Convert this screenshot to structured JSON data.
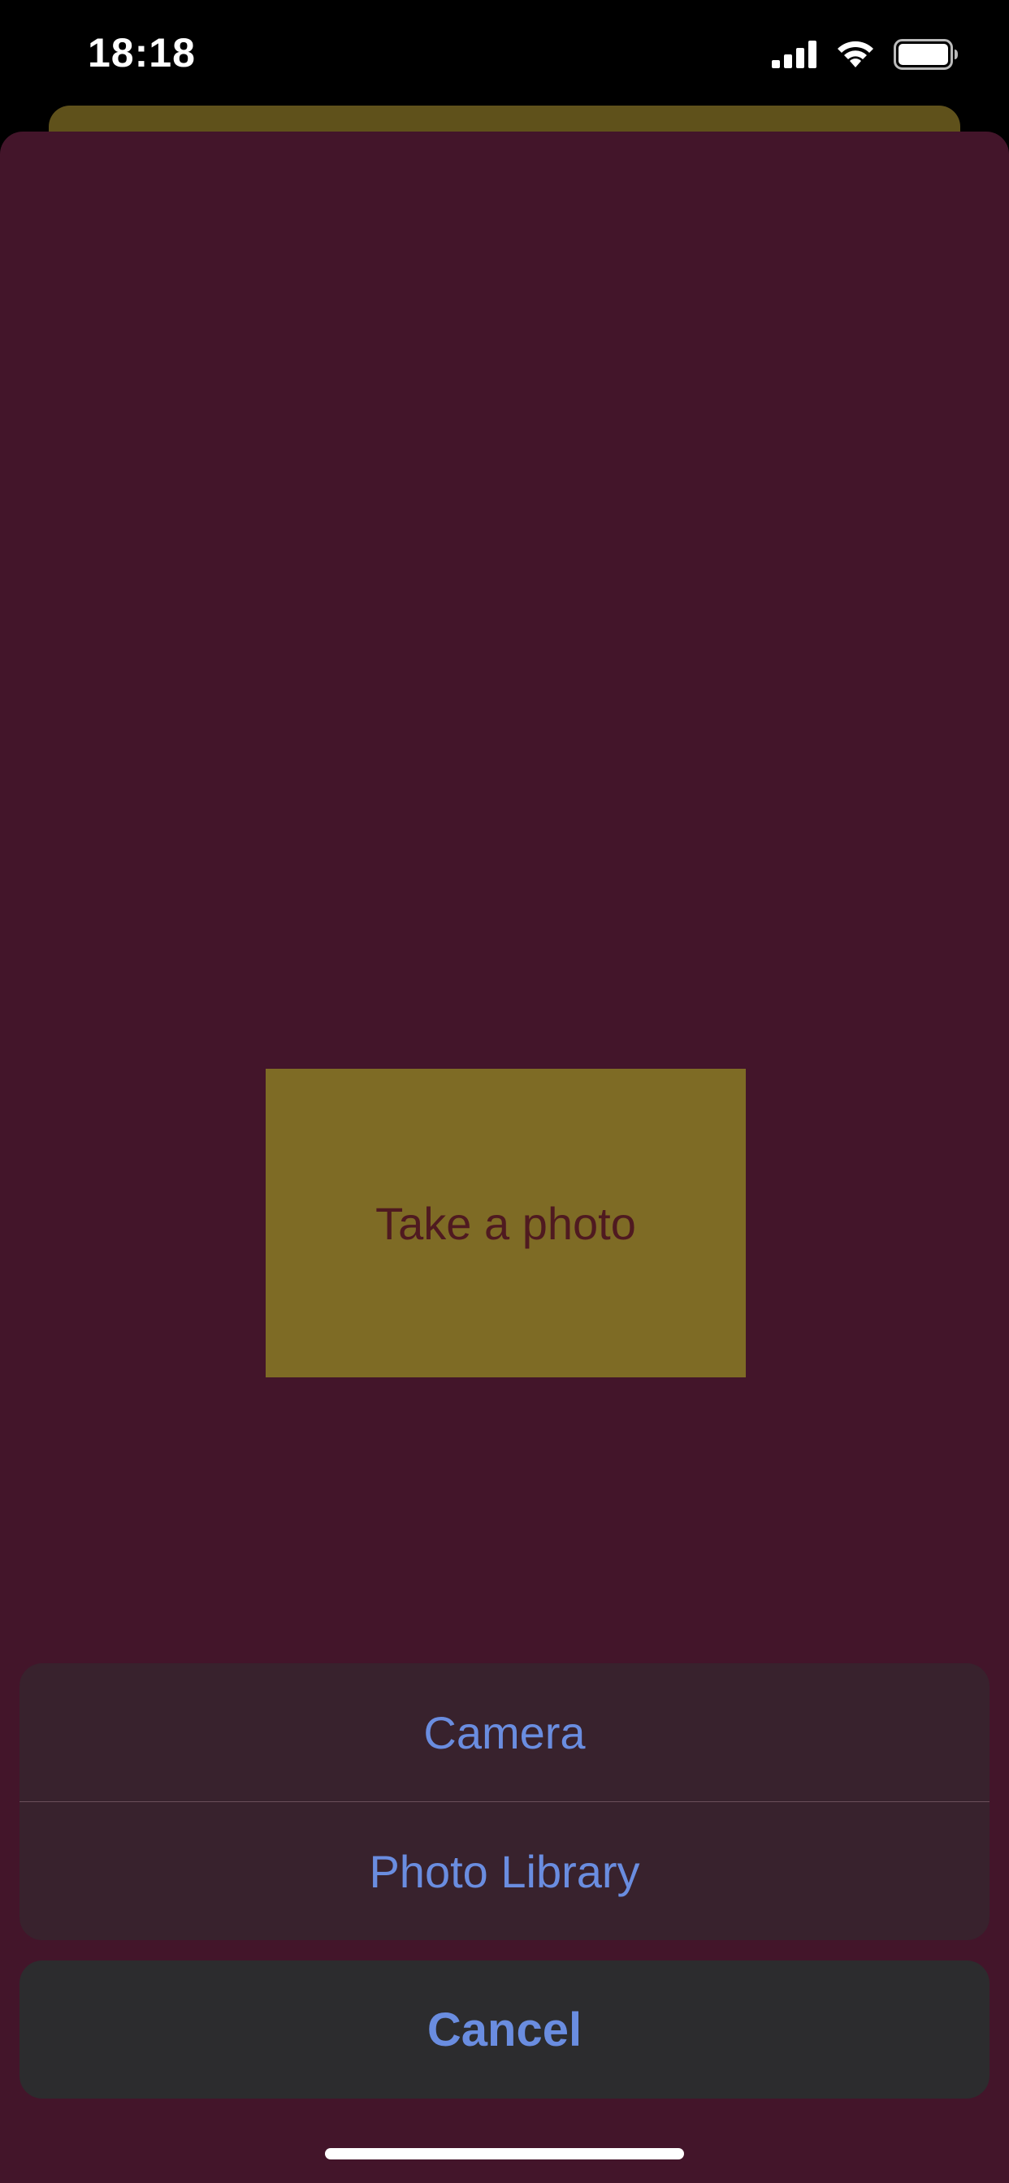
{
  "status_bar": {
    "time": "18:18",
    "icons": [
      "cellular-signal-icon",
      "wifi-icon",
      "battery-icon"
    ]
  },
  "main": {
    "photo_button_label": "Take a photo"
  },
  "action_sheet": {
    "items": [
      {
        "label": "Camera"
      },
      {
        "label": "Photo Library"
      }
    ],
    "cancel_label": "Cancel"
  },
  "colors": {
    "sheet_background": "#43152a",
    "photo_button": "#7e6b25",
    "action_text": "#6a8de0",
    "action_group_background": "#38222d",
    "cancel_background": "#2c2c2e"
  }
}
